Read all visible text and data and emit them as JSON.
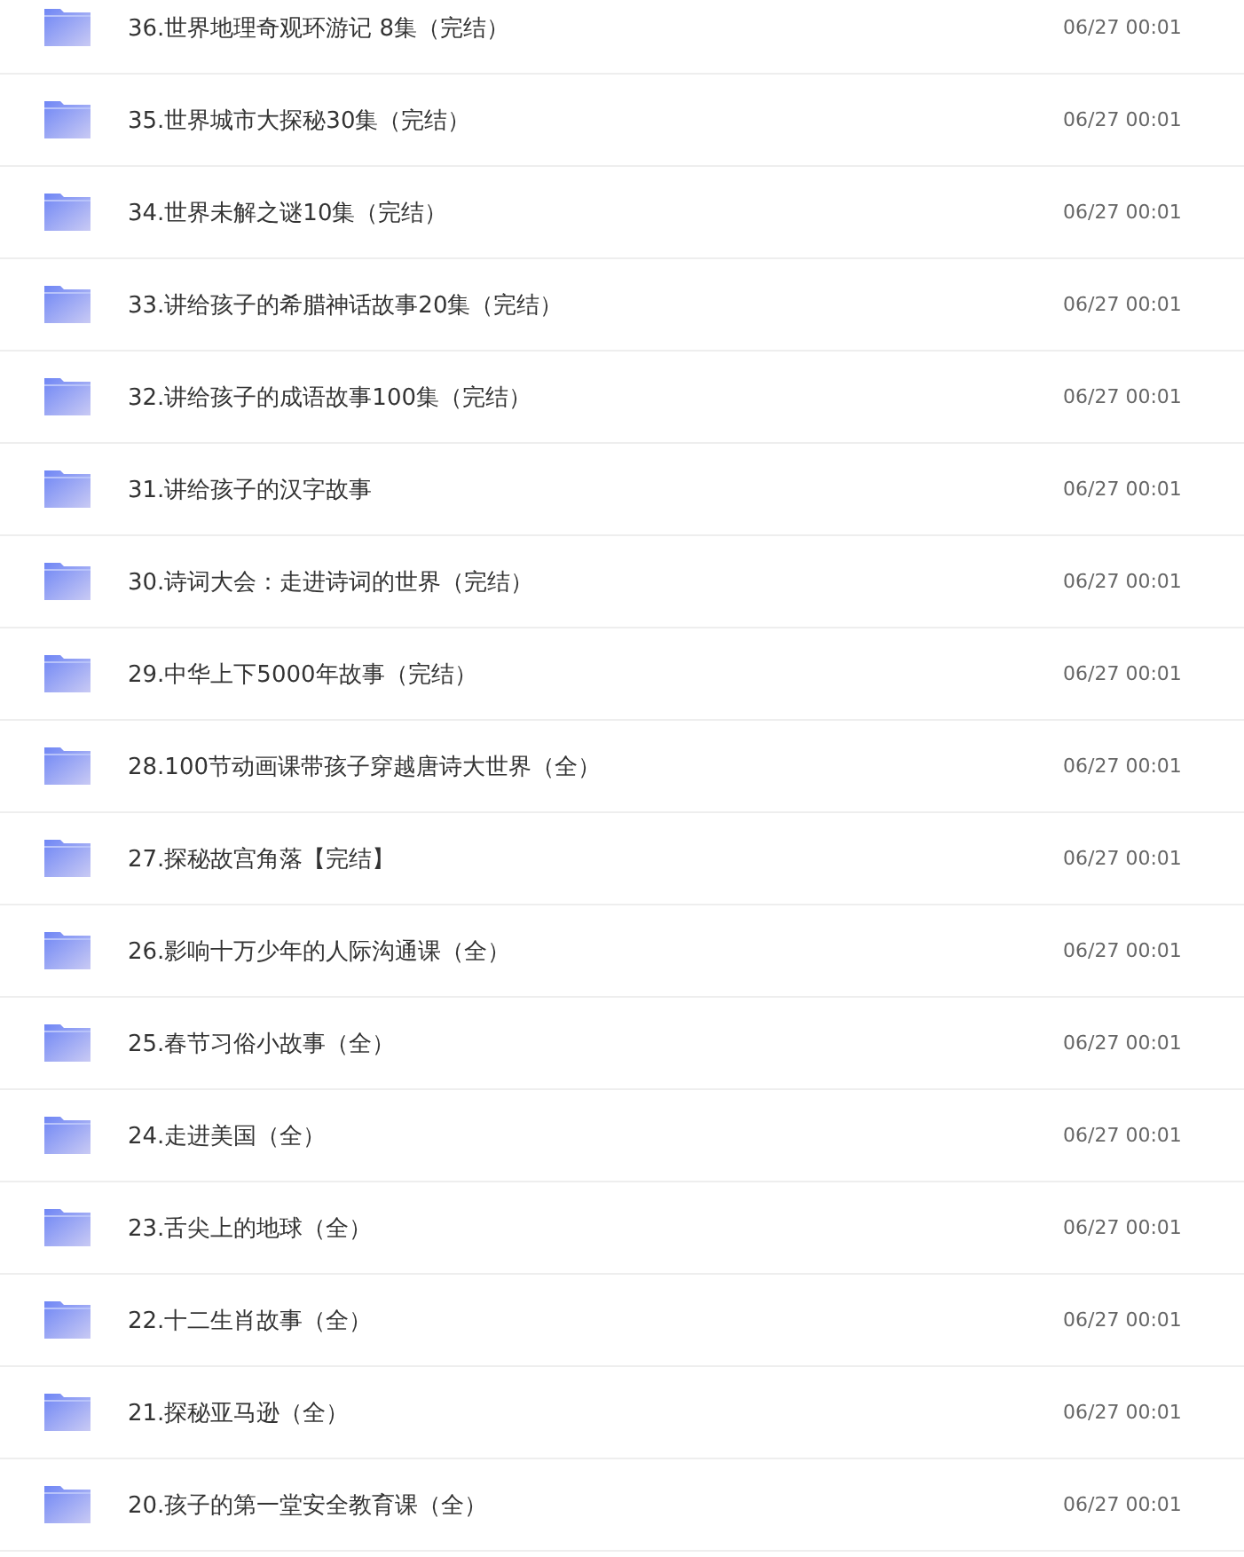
{
  "files": [
    {
      "name": "36.世界地理奇观环游记 8集（完结）",
      "time": "06/27 00:01"
    },
    {
      "name": "35.世界城市大探秘30集（完结）",
      "time": "06/27 00:01"
    },
    {
      "name": "34.世界未解之谜10集（完结）",
      "time": "06/27 00:01"
    },
    {
      "name": "33.讲给孩子的希腊神话故事20集（完结）",
      "time": "06/27 00:01"
    },
    {
      "name": "32.讲给孩子的成语故事100集（完结）",
      "time": "06/27 00:01"
    },
    {
      "name": "31.讲给孩子的汉字故事",
      "time": "06/27 00:01"
    },
    {
      "name": "30.诗词大会：走进诗词的世界（完结）",
      "time": "06/27 00:01"
    },
    {
      "name": "29.中华上下5000年故事（完结）",
      "time": "06/27 00:01"
    },
    {
      "name": "28.100节动画课带孩子穿越唐诗大世界（全）",
      "time": "06/27 00:01"
    },
    {
      "name": "27.探秘故宫角落【完结】",
      "time": "06/27 00:01"
    },
    {
      "name": "26.影响十万少年的人际沟通课（全）",
      "time": "06/27 00:01"
    },
    {
      "name": "25.春节习俗小故事（全）",
      "time": "06/27 00:01"
    },
    {
      "name": "24.走进美国（全）",
      "time": "06/27 00:01"
    },
    {
      "name": "23.舌尖上的地球（全）",
      "time": "06/27 00:01"
    },
    {
      "name": "22.十二生肖故事（全）",
      "time": "06/27 00:01"
    },
    {
      "name": "21.探秘亚马逊（全）",
      "time": "06/27 00:01"
    },
    {
      "name": "20.孩子的第一堂安全教育课（全）",
      "time": "06/27 00:01"
    }
  ]
}
